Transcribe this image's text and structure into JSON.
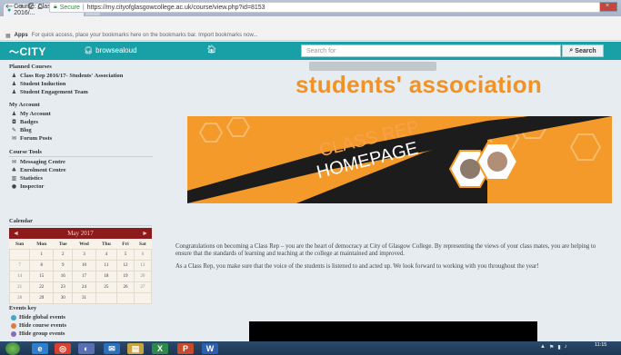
{
  "browser": {
    "tab_title": "Course: Class Rep 2016/...",
    "tab_close": "×",
    "window_controls": [
      "–",
      "▫",
      "×"
    ],
    "nav": {
      "back": "←",
      "forward": "→",
      "reload": "C",
      "home": "⌂"
    },
    "secure_label": "Secure",
    "url": "https://my.cityofglasgowcollege.ac.uk/course/view.php?id=8153",
    "bookmarks_bar": {
      "apps": "Apps",
      "hint": "For quick access, place your bookmarks here on the bookmarks bar. Import bookmarks now..."
    }
  },
  "site_header": {
    "logo": "CITY",
    "browse": "browsealoud",
    "search_placeholder": "Search for",
    "search_button": "Search"
  },
  "sidebar": {
    "planned_courses": {
      "heading": "Planned Courses",
      "items": [
        {
          "label": "Class Rep 2016/17- Students' Association",
          "icon": "person-icon"
        },
        {
          "label": "Student Induction",
          "icon": "person-icon"
        },
        {
          "label": "Student Engagement Team",
          "icon": "person-icon"
        }
      ]
    },
    "my_account": {
      "heading": "My Account",
      "items": [
        {
          "label": "My Account",
          "icon": "user-icon"
        },
        {
          "label": "Badges",
          "icon": "badge-icon"
        },
        {
          "label": "Blog",
          "icon": "blog-icon"
        },
        {
          "label": "Forum Posts",
          "icon": "forum-icon"
        }
      ]
    },
    "course_tools": {
      "heading": "Course Tools",
      "items": [
        {
          "label": "Messaging Centre",
          "icon": "mail-icon"
        },
        {
          "label": "Enrolment Centre",
          "icon": "enrol-icon"
        },
        {
          "label": "Statistics",
          "icon": "stats-icon"
        },
        {
          "label": "Inspector",
          "icon": "info-icon"
        }
      ]
    }
  },
  "calendar": {
    "heading": "Calendar",
    "prev": "◄",
    "month": "May 2017",
    "next": "►",
    "days": [
      "Sun",
      "Mon",
      "Tue",
      "Wed",
      "Thu",
      "Fri",
      "Sat"
    ],
    "weeks": [
      [
        "",
        "1",
        "2",
        "3",
        "4",
        "5",
        "6"
      ],
      [
        "7",
        "8",
        "9",
        "10",
        "11",
        "12",
        "13"
      ],
      [
        "14",
        "15",
        "16",
        "17",
        "18",
        "19",
        "20"
      ],
      [
        "21",
        "22",
        "23",
        "24",
        "25",
        "26",
        "27"
      ],
      [
        "28",
        "29",
        "30",
        "31",
        "",
        "",
        ""
      ]
    ]
  },
  "events_key": {
    "heading": "Events key",
    "items": [
      {
        "label": "Hide global events",
        "color": "#4aa3c8"
      },
      {
        "label": "Hide course events",
        "color": "#e07a3a"
      },
      {
        "label": "Hide group events",
        "color": "#8a6bb8"
      }
    ]
  },
  "main": {
    "association_title": "students' association",
    "banner_line1": "CLASS REP",
    "banner_line2": "HOMEPAGE",
    "intro_p1": "Congratulations on becoming a Class Rep – you are the heart of democracy at City of Glasgow College. By representing the views of your class mates, you are helping to ensure that the standards of learning and teaching at the college at maintained and improved.",
    "intro_p2": "As a Class Rep, you make sure that the voice of the students is listened to and acted up. We look forward to working with you throughout the year!"
  },
  "taskbar": {
    "apps": [
      {
        "label": "e",
        "color": "#2f7fd1",
        "icon": "ie-icon"
      },
      {
        "label": "◎",
        "color": "#d9412f",
        "icon": "chrome-icon"
      },
      {
        "label": "◐",
        "color": "#5a6fb3",
        "icon": "app-icon"
      },
      {
        "label": "✉",
        "color": "#2d6fb8",
        "icon": "mail-icon"
      },
      {
        "label": "▤",
        "color": "#c9a241",
        "icon": "folder-icon"
      },
      {
        "label": "X",
        "color": "#2e8a4a",
        "icon": "excel-icon"
      },
      {
        "label": "P",
        "color": "#c54b2c",
        "icon": "powerpoint-icon"
      },
      {
        "label": "W",
        "color": "#2e5fae",
        "icon": "word-icon"
      }
    ],
    "time": "11:15"
  },
  "colors": {
    "teal": "#18a0a6",
    "orange": "#f39a2b",
    "calendar_header": "#8e1b1b"
  }
}
